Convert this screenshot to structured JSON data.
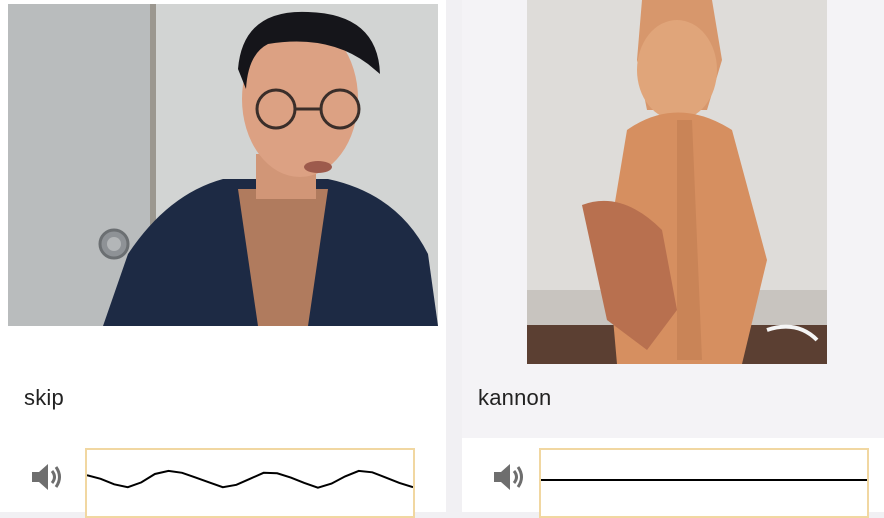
{
  "cards": [
    {
      "label": "skip",
      "photo_icon": "portrait-photo",
      "waveform": {
        "type": "line",
        "y": [
          0.2,
          0.05,
          -0.18,
          -0.3,
          -0.1,
          0.25,
          0.38,
          0.3,
          0.1,
          -0.1,
          -0.3,
          -0.2,
          0.05,
          0.3,
          0.28,
          0.1,
          -0.12,
          -0.32,
          -0.15,
          0.15,
          0.38,
          0.32,
          0.1,
          -0.12,
          -0.3
        ]
      }
    },
    {
      "label": "kannon",
      "photo_icon": "statue-photo",
      "waveform": {
        "type": "line",
        "y": [
          0,
          0,
          0,
          0,
          0,
          0,
          0,
          0,
          0,
          0,
          0,
          0,
          0,
          0,
          0,
          0,
          0,
          0,
          0,
          0,
          0,
          0,
          0,
          0,
          0
        ]
      }
    }
  ],
  "icons": {
    "speaker": "speaker-icon"
  },
  "colors": {
    "wave_border": "#f1d7a1",
    "wave_line": "#000000"
  }
}
